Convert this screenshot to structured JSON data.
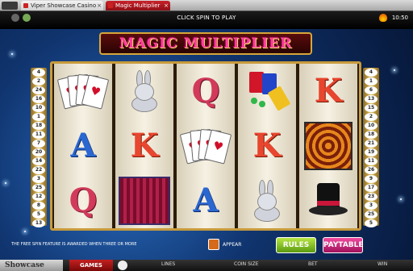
{
  "window": {
    "tabs": [
      {
        "label": "Viper Showcase Casino"
      },
      {
        "label": "Magic Multiplier"
      }
    ]
  },
  "topbar": {
    "prompt": "CLICK SPIN TO PLAY",
    "clock": "10:50"
  },
  "game": {
    "title": "MAGIC MULTIPLIER",
    "paylines_left": [
      4,
      2,
      24,
      16,
      10,
      1,
      18,
      11,
      7,
      20,
      14,
      22,
      3,
      25,
      12,
      8,
      5,
      13
    ],
    "paylines_right": [
      4,
      1,
      6,
      13,
      15,
      2,
      10,
      18,
      21,
      19,
      11,
      26,
      9,
      17,
      23,
      3,
      25,
      5
    ],
    "reels": [
      [
        "cards",
        "A",
        "Q"
      ],
      [
        "rabbit",
        "K",
        "curtain"
      ],
      [
        "Q",
        "cards",
        "A"
      ],
      [
        "magic-kit",
        "K",
        "rabbit"
      ],
      [
        "K",
        "spiral",
        "top-hat"
      ]
    ]
  },
  "bottom": {
    "notice": "THE FREE SPIN FEATURE IS AWARDED WHEN THREE OR MORE",
    "appear": "APPEAR",
    "rules_label": "RULES",
    "paytable_label": "PAYTABLE"
  },
  "footer": {
    "brand": "Showcase",
    "games_label": "GAMES",
    "lines_label": "LINES",
    "coin_label": "COIN SIZE",
    "bet_label": "BET",
    "win_label": "WIN"
  },
  "colors": {
    "backdrop": "#10346e",
    "frame_gold": "#c89b3c",
    "logo_pink": "#ff3aa0",
    "rules_green": "#5a9a10",
    "paytable_pink": "#a0105a",
    "games_red": "#c42020"
  }
}
